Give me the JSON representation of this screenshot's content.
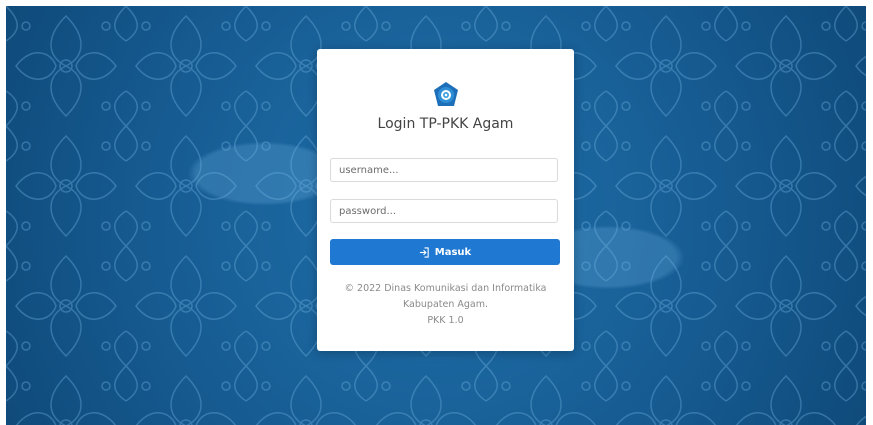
{
  "login": {
    "title": "Login TP-PKK Agam",
    "username_placeholder": "username...",
    "password_placeholder": "password...",
    "submit_label": "Masuk",
    "submit_icon": "sign-in-icon",
    "logo_icon": "pkk-emblem-icon"
  },
  "footer": {
    "copyright_line1": "© 2022 Dinas Komunikasi dan Informatika",
    "copyright_line2": "Kabupaten Agam.",
    "version": "PKK 1.0"
  },
  "colors": {
    "background": "#1a66a1",
    "button": "#1f78d1",
    "card": "#ffffff"
  }
}
